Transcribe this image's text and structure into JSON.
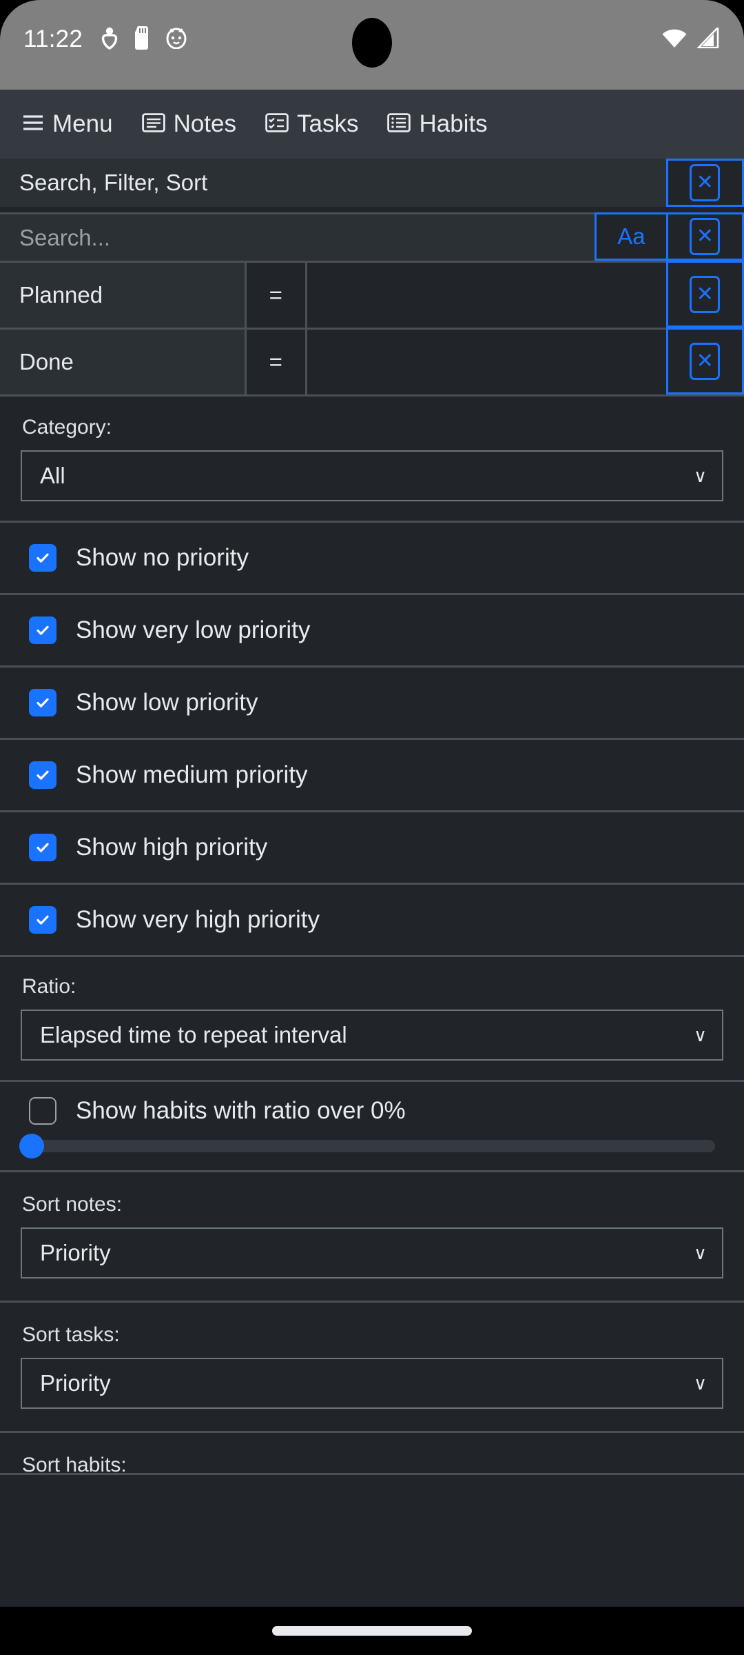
{
  "statusbar": {
    "time": "11:22",
    "left_icons": [
      "accessibility-person-icon",
      "sd-card-icon",
      "cat-face-icon"
    ],
    "right_icons": [
      "wifi-icon",
      "cell-signal-icon"
    ]
  },
  "toolbar": {
    "items": [
      {
        "label": "Menu",
        "icon": "hamburger-menu-icon"
      },
      {
        "label": "Notes",
        "icon": "notes-icon"
      },
      {
        "label": "Tasks",
        "icon": "tasks-checklist-icon"
      },
      {
        "label": "Habits",
        "icon": "habits-list-icon"
      }
    ]
  },
  "panel": {
    "title": "Search, Filter, Sort",
    "close_label": "✕"
  },
  "filters": {
    "search": {
      "placeholder": "Search...",
      "value": "",
      "match_case_label": "Aa",
      "close_label": "✕"
    },
    "rows": [
      {
        "field": "Planned",
        "operator": "=",
        "value": "",
        "close_label": "✕"
      },
      {
        "field": "Done",
        "operator": "=",
        "value": "",
        "close_label": "✕"
      }
    ]
  },
  "category": {
    "label": "Category:",
    "value": "All",
    "chevron": "∨"
  },
  "priority_checkboxes": [
    {
      "label": "Show no priority",
      "checked": true
    },
    {
      "label": "Show very low priority",
      "checked": true
    },
    {
      "label": "Show low priority",
      "checked": true
    },
    {
      "label": "Show medium priority",
      "checked": true
    },
    {
      "label": "Show high priority",
      "checked": true
    },
    {
      "label": "Show very high priority",
      "checked": true
    }
  ],
  "ratio": {
    "label": "Ratio:",
    "value": "Elapsed time to repeat interval",
    "chevron": "∨"
  },
  "ratio_filter": {
    "label": "Show habits with ratio over 0%",
    "checked": false,
    "slider_value": 0,
    "slider_min": 0,
    "slider_max": 100
  },
  "sort_notes": {
    "label": "Sort notes:",
    "value": "Priority",
    "chevron": "∨"
  },
  "sort_tasks": {
    "label": "Sort tasks:",
    "value": "Priority",
    "chevron": "∨"
  },
  "sort_habits": {
    "label": "Sort habits:"
  },
  "colors": {
    "accent": "#1a73ff",
    "panel_bg": "#212529",
    "row_bg": "#2b3035",
    "toolbar_bg": "#343a40",
    "divider": "#495057",
    "text": "#e8eaed",
    "muted": "#9aa0a6"
  }
}
